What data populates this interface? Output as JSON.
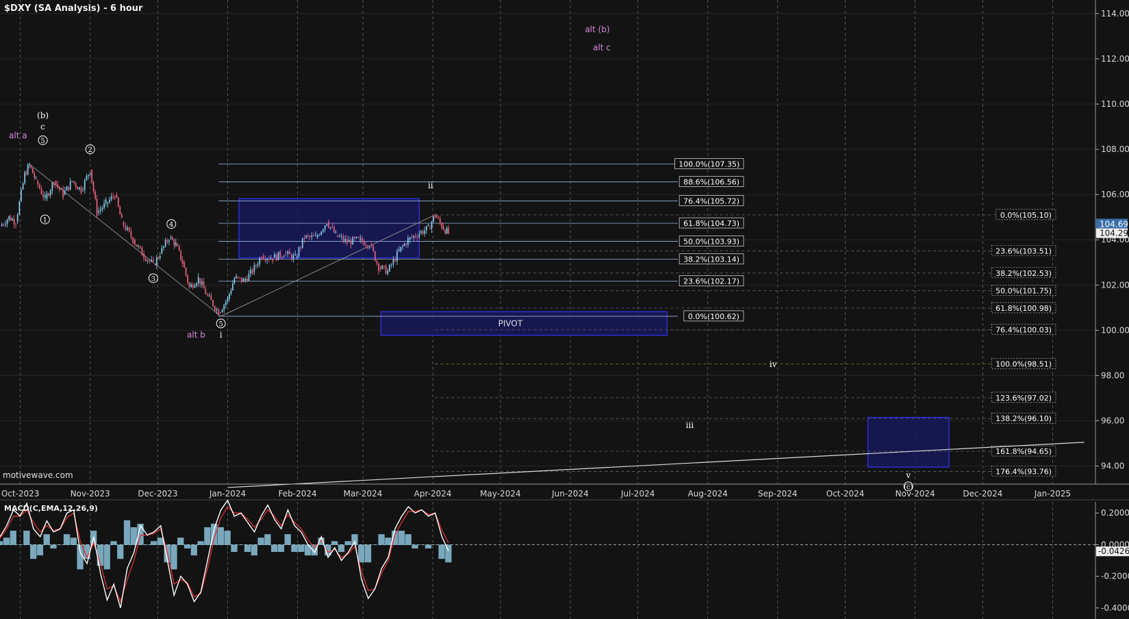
{
  "title": "$DXY (SA Analysis) - 6 hour",
  "watermark": "motivewave.com",
  "colors": {
    "background": "#131313",
    "grid": "#6a6a6a",
    "candle_up": "#7fc6e8",
    "candle_down": "#e0607a",
    "box_fill": "#17195a",
    "box_stroke": "#2c34e6",
    "fib_line_left": "#8aa3c6",
    "fib_line_right": "#5e5e5e",
    "fib_100_line": "#7a7a30",
    "alt_label": "#d88be0",
    "macd_line": "#ffffff",
    "signal_line": "#e03030",
    "histogram": "#8cc3dc",
    "last_price_box": "#3a6ea8"
  },
  "x_axis": {
    "labels": [
      "Oct-2023",
      "Nov-2023",
      "Dec-2023",
      "Jan-2024",
      "Feb-2024",
      "Mar-2024",
      "Apr-2024",
      "May-2024",
      "Jun-2024",
      "Jul-2024",
      "Aug-2024",
      "Sep-2024",
      "Oct-2024",
      "Nov-2024",
      "Dec-2024",
      "Jan-2025"
    ]
  },
  "chart_data": [
    {
      "type": "candlestick",
      "title": "$DXY (SA Analysis) - 6 hour",
      "x_range": [
        "2023-09-22",
        "2025-01-20"
      ],
      "ylim": [
        93.2,
        114.6
      ],
      "y_ticks": [
        "114.00",
        "112.00",
        "110.00",
        "108.00",
        "106.00",
        "104.00",
        "102.00",
        "100.00",
        "98.00",
        "96.00",
        "94.00"
      ],
      "last_price_labels": [
        "104.69",
        "104.29"
      ],
      "grid": true,
      "price_path": [
        {
          "date": "2023-09-22",
          "value": 104.6
        },
        {
          "date": "2023-09-26",
          "value": 105.0
        },
        {
          "date": "2023-09-29",
          "value": 104.8
        },
        {
          "date": "2023-10-03",
          "value": 106.9
        },
        {
          "date": "2023-10-05",
          "value": 107.3
        },
        {
          "date": "2023-10-08",
          "value": 106.6
        },
        {
          "date": "2023-10-12",
          "value": 105.8
        },
        {
          "date": "2023-10-16",
          "value": 106.6
        },
        {
          "date": "2023-10-20",
          "value": 106.0
        },
        {
          "date": "2023-10-24",
          "value": 106.6
        },
        {
          "date": "2023-10-28",
          "value": 106.2
        },
        {
          "date": "2023-11-01",
          "value": 107.1
        },
        {
          "date": "2023-11-04",
          "value": 105.2
        },
        {
          "date": "2023-11-08",
          "value": 105.6
        },
        {
          "date": "2023-11-12",
          "value": 106.0
        },
        {
          "date": "2023-11-15",
          "value": 104.8
        },
        {
          "date": "2023-11-20",
          "value": 104.0
        },
        {
          "date": "2023-11-24",
          "value": 103.4
        },
        {
          "date": "2023-11-29",
          "value": 102.9
        },
        {
          "date": "2023-12-02",
          "value": 103.4
        },
        {
          "date": "2023-12-06",
          "value": 104.1
        },
        {
          "date": "2023-12-09",
          "value": 103.8
        },
        {
          "date": "2023-12-12",
          "value": 103.0
        },
        {
          "date": "2023-12-15",
          "value": 101.9
        },
        {
          "date": "2023-12-19",
          "value": 102.3
        },
        {
          "date": "2023-12-23",
          "value": 101.5
        },
        {
          "date": "2023-12-28",
          "value": 100.8
        },
        {
          "date": "2024-01-01",
          "value": 101.4
        },
        {
          "date": "2024-01-04",
          "value": 102.3
        },
        {
          "date": "2024-01-08",
          "value": 102.2
        },
        {
          "date": "2024-01-12",
          "value": 102.6
        },
        {
          "date": "2024-01-16",
          "value": 103.3
        },
        {
          "date": "2024-01-21",
          "value": 103.2
        },
        {
          "date": "2024-01-26",
          "value": 103.4
        },
        {
          "date": "2024-01-31",
          "value": 103.2
        },
        {
          "date": "2024-02-04",
          "value": 104.1
        },
        {
          "date": "2024-02-09",
          "value": 104.1
        },
        {
          "date": "2024-02-14",
          "value": 104.8
        },
        {
          "date": "2024-02-18",
          "value": 104.2
        },
        {
          "date": "2024-02-23",
          "value": 103.9
        },
        {
          "date": "2024-02-28",
          "value": 104.0
        },
        {
          "date": "2024-03-04",
          "value": 103.8
        },
        {
          "date": "2024-03-08",
          "value": 102.8
        },
        {
          "date": "2024-03-12",
          "value": 102.6
        },
        {
          "date": "2024-03-17",
          "value": 103.5
        },
        {
          "date": "2024-03-21",
          "value": 104.0
        },
        {
          "date": "2024-03-26",
          "value": 104.3
        },
        {
          "date": "2024-03-30",
          "value": 104.5
        },
        {
          "date": "2024-04-02",
          "value": 105.1
        },
        {
          "date": "2024-04-05",
          "value": 104.6
        },
        {
          "date": "2024-04-08",
          "value": 104.29
        }
      ]
    },
    {
      "type": "line",
      "title": "MACD(C,EMA,12,26,9)",
      "ylim": [
        -0.47,
        0.27
      ],
      "y_ticks": [
        "0.2000",
        "0.0000",
        "-0.2000",
        "-0.4000"
      ],
      "last_value_label": "-0.0426",
      "series": [
        {
          "name": "macd",
          "values": [
            0.05,
            0.12,
            0.22,
            0.18,
            0.26,
            0.1,
            0.05,
            0.15,
            0.08,
            0.1,
            0.2,
            0.22,
            -0.05,
            -0.12,
            0.05,
            -0.18,
            -0.35,
            -0.25,
            -0.4,
            -0.15,
            -0.05,
            0.12,
            0.06,
            0.08,
            0.12,
            -0.1,
            -0.32,
            -0.2,
            -0.25,
            -0.36,
            -0.3,
            -0.1,
            0.1,
            0.22,
            0.28,
            0.18,
            0.2,
            0.14,
            0.08,
            0.18,
            0.25,
            0.16,
            0.1,
            0.22,
            0.12,
            0.08,
            0.0,
            -0.05,
            0.05,
            -0.08,
            -0.02,
            -0.1,
            -0.05,
            0.02,
            -0.22,
            -0.34,
            -0.28,
            -0.15,
            -0.08,
            0.1,
            0.18,
            0.24,
            0.2,
            0.22,
            0.18,
            0.2,
            0.05,
            -0.04
          ]
        },
        {
          "name": "signal",
          "values": [
            0.04,
            0.1,
            0.18,
            0.18,
            0.22,
            0.14,
            0.08,
            0.12,
            0.09,
            0.1,
            0.17,
            0.2,
            0.02,
            -0.08,
            0.01,
            -0.12,
            -0.28,
            -0.26,
            -0.36,
            -0.22,
            -0.1,
            0.06,
            0.06,
            0.07,
            0.1,
            -0.05,
            -0.25,
            -0.22,
            -0.24,
            -0.33,
            -0.31,
            -0.15,
            0.04,
            0.17,
            0.24,
            0.2,
            0.2,
            0.16,
            0.11,
            0.16,
            0.22,
            0.18,
            0.12,
            0.19,
            0.14,
            0.1,
            0.03,
            -0.02,
            0.03,
            -0.05,
            -0.03,
            -0.08,
            -0.06,
            -0.01,
            -0.17,
            -0.29,
            -0.28,
            -0.18,
            -0.1,
            0.06,
            0.14,
            0.21,
            0.21,
            0.22,
            0.19,
            0.2,
            0.09,
            0.01
          ]
        },
        {
          "name": "histogram",
          "values": [
            0.01,
            0.02,
            0.04,
            0.0,
            0.04,
            -0.04,
            -0.03,
            0.03,
            -0.01,
            0.0,
            0.03,
            0.02,
            -0.07,
            -0.04,
            0.04,
            -0.06,
            -0.07,
            0.01,
            -0.04,
            0.07,
            0.05,
            0.06,
            0.0,
            0.01,
            0.02,
            -0.05,
            -0.07,
            0.02,
            -0.01,
            -0.03,
            0.01,
            0.05,
            0.06,
            0.05,
            0.04,
            -0.02,
            0.0,
            -0.02,
            -0.03,
            0.02,
            0.03,
            -0.02,
            -0.02,
            0.03,
            -0.02,
            -0.02,
            -0.03,
            -0.03,
            0.02,
            -0.03,
            0.01,
            -0.02,
            0.01,
            0.03,
            -0.05,
            -0.05,
            0.0,
            0.03,
            0.02,
            0.04,
            0.04,
            0.03,
            -0.01,
            0.0,
            -0.01,
            0.0,
            -0.04,
            -0.05
          ]
        }
      ]
    }
  ],
  "fib_left": [
    {
      "label": "100.0%(107.35)",
      "value": 107.35
    },
    {
      "label": "88.6%(106.56)",
      "value": 106.56
    },
    {
      "label": "76.4%(105.72)",
      "value": 105.72
    },
    {
      "label": "61.8%(104.73)",
      "value": 104.73
    },
    {
      "label": "50.0%(103.93)",
      "value": 103.93
    },
    {
      "label": "38.2%(103.14)",
      "value": 103.14
    },
    {
      "label": "23.6%(102.17)",
      "value": 102.17
    },
    {
      "label": "0.0%(100.62)",
      "value": 100.62
    }
  ],
  "fib_right": [
    {
      "label": "0.0%(105.10)",
      "value": 105.1
    },
    {
      "label": "23.6%(103.51)",
      "value": 103.51
    },
    {
      "label": "38.2%(102.53)",
      "value": 102.53
    },
    {
      "label": "50.0%(101.75)",
      "value": 101.75
    },
    {
      "label": "61.8%(100.98)",
      "value": 100.98
    },
    {
      "label": "76.4%(100.03)",
      "value": 100.03
    },
    {
      "label": "100.0%(98.51)",
      "value": 98.51
    },
    {
      "label": "123.6%(97.02)",
      "value": 97.02
    },
    {
      "label": "138.2%(96.10)",
      "value": 96.1
    },
    {
      "label": "161.8%(94.65)",
      "value": 94.65
    },
    {
      "label": "176.4%(93.76)",
      "value": 93.76
    }
  ],
  "boxes": [
    {
      "name": "upper-resistance-box",
      "from": "2024-01-06",
      "to": "2024-03-26",
      "top": 105.82,
      "bottom": 103.2
    },
    {
      "name": "pivot-box",
      "from": "2024-03-09",
      "to": "2024-07-14",
      "top": 100.82,
      "bottom": 99.78,
      "label": "PIVOT"
    },
    {
      "name": "target-box",
      "from": "2024-10-11",
      "to": "2024-11-16",
      "top": 96.15,
      "bottom": 93.95
    }
  ],
  "wave_labels": [
    {
      "text": "(b)",
      "date": "2023-10-11",
      "value": 109.5,
      "kind": "wave"
    },
    {
      "text": "c",
      "date": "2023-10-11",
      "value": 109.0,
      "kind": "wave"
    },
    {
      "text": "5",
      "date": "2023-10-11",
      "value": 108.4,
      "kind": "circle"
    },
    {
      "text": "alt a",
      "date": "2023-09-30",
      "value": 108.6,
      "kind": "alt"
    },
    {
      "text": "2",
      "date": "2023-11-01",
      "value": 108.0,
      "kind": "circle"
    },
    {
      "text": "1",
      "date": "2023-10-12",
      "value": 104.9,
      "kind": "circle"
    },
    {
      "text": "4",
      "date": "2023-12-07",
      "value": 104.7,
      "kind": "circle"
    },
    {
      "text": "3",
      "date": "2023-11-29",
      "value": 102.3,
      "kind": "circle"
    },
    {
      "text": "5",
      "date": "2023-12-29",
      "value": 100.3,
      "kind": "circle"
    },
    {
      "text": "i",
      "date": "2023-12-29",
      "value": 99.8,
      "kind": "wave"
    },
    {
      "text": "alt b",
      "date": "2023-12-18",
      "value": 99.8,
      "kind": "alt"
    },
    {
      "text": "ii",
      "date": "2024-03-31",
      "value": 106.4,
      "kind": "wave"
    },
    {
      "text": "alt (b)",
      "date": "2024-06-13",
      "value": 113.3,
      "kind": "alt"
    },
    {
      "text": "alt c",
      "date": "2024-06-15",
      "value": 112.5,
      "kind": "alt"
    },
    {
      "text": "iii",
      "date": "2024-07-24",
      "value": 95.8,
      "kind": "wave"
    },
    {
      "text": "iv",
      "date": "2024-08-30",
      "value": 98.5,
      "kind": "wave"
    },
    {
      "text": "v",
      "date": "2024-10-29",
      "value": 93.6,
      "kind": "wave"
    },
    {
      "text": "(c)",
      "date": "2024-10-29",
      "value": 93.1,
      "kind": "circle"
    }
  ],
  "trendlines": [
    {
      "name": "wave-a-line",
      "from": {
        "date": "2023-10-05",
        "value": 107.35
      },
      "to": {
        "date": "2023-12-29",
        "value": 100.62
      }
    },
    {
      "name": "wave-b-line",
      "from": {
        "date": "2023-12-29",
        "value": 100.62
      },
      "to": {
        "date": "2024-04-02",
        "value": 105.1
      }
    },
    {
      "name": "long-support-line",
      "from": {
        "date": "2024-01-01",
        "value": 93.05
      },
      "to": {
        "date": "2025-01-15",
        "value": 95.05
      }
    }
  ]
}
